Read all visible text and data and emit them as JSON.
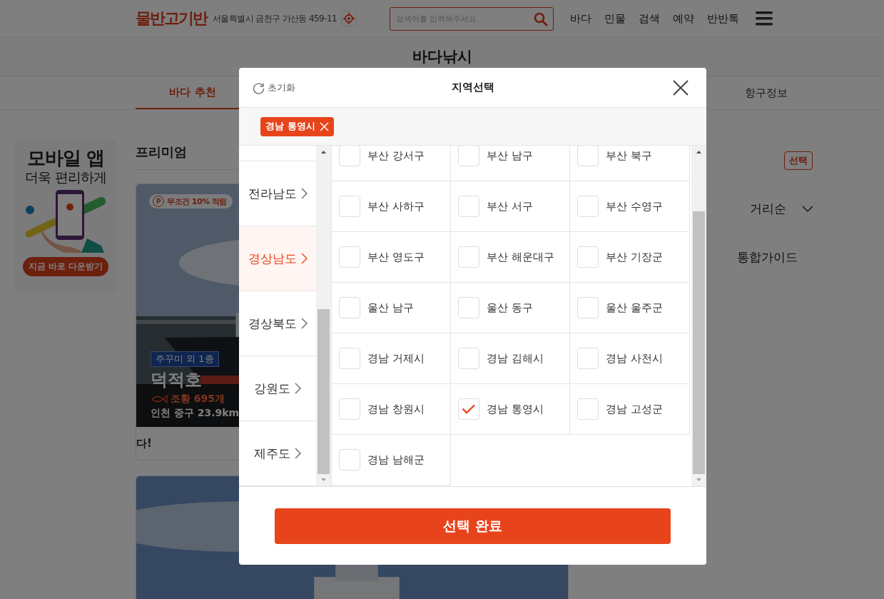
{
  "header": {
    "logo": "물반고기반",
    "address": "서울특별시 금천구 가산동 459-11",
    "search": {
      "placeholder": "검색어를 입력해주세요."
    },
    "nav": [
      "바다",
      "민물",
      "검색",
      "예약",
      "반반톡"
    ]
  },
  "page_title": "바다낚시",
  "tabs": [
    {
      "label": "바다 추천",
      "selected": true
    },
    {
      "label": "항구정보",
      "selected": false
    }
  ],
  "ad_banner": {
    "title": "모바일 앱",
    "subtitle": "더욱 편리하게",
    "button": "지금 바로 다운받기"
  },
  "section_title": "프리미엄",
  "cards": [
    {
      "kind": "detail",
      "badge_mark": "P",
      "badge": "무조건 10% 적립",
      "species": "주꾸미 외 1종",
      "name": "덕적호",
      "catch": "조황 695개",
      "location": "인천 중구 23.9km",
      "caption": "다!"
    },
    {
      "kind": "picture"
    }
  ],
  "right_panel": {
    "select_button": "선택",
    "sort": "거리순",
    "guide": "통합가이드"
  },
  "modal": {
    "reset": "초기화",
    "title": "지역선택",
    "chips": [
      "경남 통영시"
    ],
    "regions": [
      {
        "label": "전라남도",
        "selected": false
      },
      {
        "label": "경상남도",
        "selected": true
      },
      {
        "label": "경상북도",
        "selected": false
      },
      {
        "label": "강원도",
        "selected": false
      },
      {
        "label": "제주도",
        "selected": false
      }
    ],
    "districts": [
      {
        "label": "부산 강서구",
        "checked": false
      },
      {
        "label": "부산 남구",
        "checked": false
      },
      {
        "label": "부산 북구",
        "checked": false
      },
      {
        "label": "부산 사하구",
        "checked": false
      },
      {
        "label": "부산 서구",
        "checked": false
      },
      {
        "label": "부산 수영구",
        "checked": false
      },
      {
        "label": "부산 영도구",
        "checked": false
      },
      {
        "label": "부산 해운대구",
        "checked": false
      },
      {
        "label": "부산 기장군",
        "checked": false
      },
      {
        "label": "울산 남구",
        "checked": false
      },
      {
        "label": "울산 동구",
        "checked": false
      },
      {
        "label": "울산 울주군",
        "checked": false
      },
      {
        "label": "경남 거제시",
        "checked": false
      },
      {
        "label": "경남 김해시",
        "checked": false
      },
      {
        "label": "경남 사천시",
        "checked": false
      },
      {
        "label": "경남 창원시",
        "checked": false
      },
      {
        "label": "경남 통영시",
        "checked": true
      },
      {
        "label": "경남 고성군",
        "checked": false
      },
      {
        "label": "경남 남해군",
        "checked": false
      }
    ],
    "confirm": "선택 완료"
  }
}
